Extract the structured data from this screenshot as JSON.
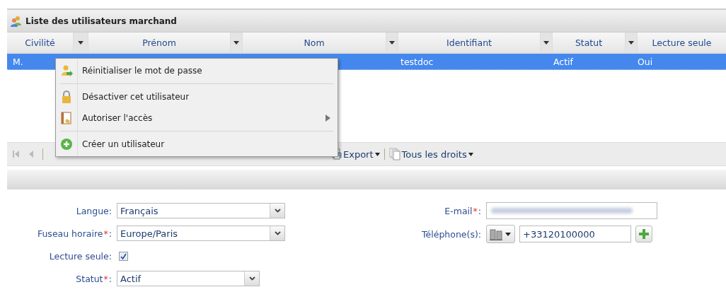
{
  "panel": {
    "title": "Liste des utilisateurs marchand"
  },
  "table": {
    "columns": [
      {
        "label": "Civilité"
      },
      {
        "label": "Prénom"
      },
      {
        "label": "Nom"
      },
      {
        "label": "Identifiant"
      },
      {
        "label": "Statut"
      },
      {
        "label": "Lecture seule"
      }
    ],
    "rows": [
      {
        "selected": true,
        "cells": [
          "M.",
          null,
          null,
          "testdoc",
          "Actif",
          "Oui"
        ]
      }
    ]
  },
  "toolbar": {
    "items": [
      {
        "label": "Export"
      },
      {
        "label": "Tous les droits"
      }
    ]
  },
  "context_menu": {
    "items": [
      {
        "kind": "item",
        "label": "Réinitialiser le mot de passe",
        "submenu": false
      },
      {
        "kind": "separator"
      },
      {
        "kind": "item",
        "label": "Désactiver cet utilisateur",
        "submenu": false
      },
      {
        "kind": "item",
        "label": "Autoriser l'accès",
        "submenu": true
      },
      {
        "kind": "separator"
      },
      {
        "kind": "item",
        "label": "Créer un utilisateur",
        "submenu": false
      }
    ]
  },
  "form": {
    "left": [
      {
        "kind": "select",
        "label": "Langue",
        "separator": ":",
        "value": "Français"
      },
      {
        "kind": "select",
        "label": "Fuseau horaire",
        "required_mark": "*",
        "separator": ":",
        "value": "Europe/Paris"
      },
      {
        "kind": "checkbox",
        "label": "Lecture seule",
        "separator": ":",
        "checked": true
      },
      {
        "kind": "select",
        "label": "Statut",
        "required_mark": "*",
        "separator": ":",
        "value": "Actif"
      }
    ],
    "right": [
      {
        "kind": "blurred",
        "label": "E-mail",
        "required_mark": "*",
        "separator": ":"
      },
      {
        "kind": "phone",
        "label": "Téléphone(s)",
        "separator": ":",
        "value": "+33120100000"
      }
    ]
  }
}
